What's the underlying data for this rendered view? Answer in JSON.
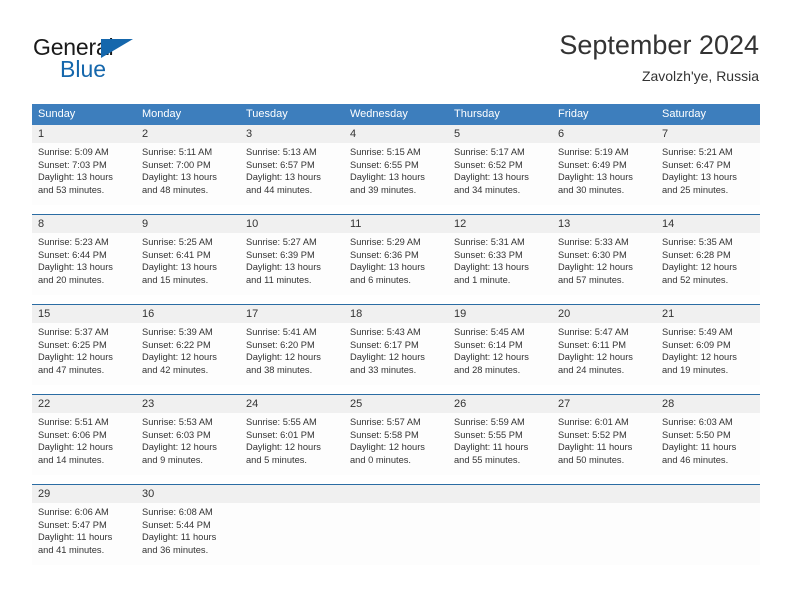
{
  "brand": {
    "name_part1": "General",
    "name_part2": "Blue",
    "logo_icon": "triangle-flag-icon"
  },
  "header": {
    "title": "September 2024",
    "subtitle": "Zavolzh'ye, Russia"
  },
  "colors": {
    "header_blue": "#3d7ebd",
    "row_divider": "#2b6ca3",
    "daynum_bg": "#f0f0f0",
    "brand_blue": "#1567ac",
    "text": "#333333"
  },
  "weekdays": [
    "Sunday",
    "Monday",
    "Tuesday",
    "Wednesday",
    "Thursday",
    "Friday",
    "Saturday"
  ],
  "weeks": [
    {
      "days": [
        {
          "date": "1",
          "sunrise": "Sunrise: 5:09 AM",
          "sunset": "Sunset: 7:03 PM",
          "daylight_line1": "Daylight: 13 hours",
          "daylight_line2": "and 53 minutes."
        },
        {
          "date": "2",
          "sunrise": "Sunrise: 5:11 AM",
          "sunset": "Sunset: 7:00 PM",
          "daylight_line1": "Daylight: 13 hours",
          "daylight_line2": "and 48 minutes."
        },
        {
          "date": "3",
          "sunrise": "Sunrise: 5:13 AM",
          "sunset": "Sunset: 6:57 PM",
          "daylight_line1": "Daylight: 13 hours",
          "daylight_line2": "and 44 minutes."
        },
        {
          "date": "4",
          "sunrise": "Sunrise: 5:15 AM",
          "sunset": "Sunset: 6:55 PM",
          "daylight_line1": "Daylight: 13 hours",
          "daylight_line2": "and 39 minutes."
        },
        {
          "date": "5",
          "sunrise": "Sunrise: 5:17 AM",
          "sunset": "Sunset: 6:52 PM",
          "daylight_line1": "Daylight: 13 hours",
          "daylight_line2": "and 34 minutes."
        },
        {
          "date": "6",
          "sunrise": "Sunrise: 5:19 AM",
          "sunset": "Sunset: 6:49 PM",
          "daylight_line1": "Daylight: 13 hours",
          "daylight_line2": "and 30 minutes."
        },
        {
          "date": "7",
          "sunrise": "Sunrise: 5:21 AM",
          "sunset": "Sunset: 6:47 PM",
          "daylight_line1": "Daylight: 13 hours",
          "daylight_line2": "and 25 minutes."
        }
      ]
    },
    {
      "days": [
        {
          "date": "8",
          "sunrise": "Sunrise: 5:23 AM",
          "sunset": "Sunset: 6:44 PM",
          "daylight_line1": "Daylight: 13 hours",
          "daylight_line2": "and 20 minutes."
        },
        {
          "date": "9",
          "sunrise": "Sunrise: 5:25 AM",
          "sunset": "Sunset: 6:41 PM",
          "daylight_line1": "Daylight: 13 hours",
          "daylight_line2": "and 15 minutes."
        },
        {
          "date": "10",
          "sunrise": "Sunrise: 5:27 AM",
          "sunset": "Sunset: 6:39 PM",
          "daylight_line1": "Daylight: 13 hours",
          "daylight_line2": "and 11 minutes."
        },
        {
          "date": "11",
          "sunrise": "Sunrise: 5:29 AM",
          "sunset": "Sunset: 6:36 PM",
          "daylight_line1": "Daylight: 13 hours",
          "daylight_line2": "and 6 minutes."
        },
        {
          "date": "12",
          "sunrise": "Sunrise: 5:31 AM",
          "sunset": "Sunset: 6:33 PM",
          "daylight_line1": "Daylight: 13 hours",
          "daylight_line2": "and 1 minute."
        },
        {
          "date": "13",
          "sunrise": "Sunrise: 5:33 AM",
          "sunset": "Sunset: 6:30 PM",
          "daylight_line1": "Daylight: 12 hours",
          "daylight_line2": "and 57 minutes."
        },
        {
          "date": "14",
          "sunrise": "Sunrise: 5:35 AM",
          "sunset": "Sunset: 6:28 PM",
          "daylight_line1": "Daylight: 12 hours",
          "daylight_line2": "and 52 minutes."
        }
      ]
    },
    {
      "days": [
        {
          "date": "15",
          "sunrise": "Sunrise: 5:37 AM",
          "sunset": "Sunset: 6:25 PM",
          "daylight_line1": "Daylight: 12 hours",
          "daylight_line2": "and 47 minutes."
        },
        {
          "date": "16",
          "sunrise": "Sunrise: 5:39 AM",
          "sunset": "Sunset: 6:22 PM",
          "daylight_line1": "Daylight: 12 hours",
          "daylight_line2": "and 42 minutes."
        },
        {
          "date": "17",
          "sunrise": "Sunrise: 5:41 AM",
          "sunset": "Sunset: 6:20 PM",
          "daylight_line1": "Daylight: 12 hours",
          "daylight_line2": "and 38 minutes."
        },
        {
          "date": "18",
          "sunrise": "Sunrise: 5:43 AM",
          "sunset": "Sunset: 6:17 PM",
          "daylight_line1": "Daylight: 12 hours",
          "daylight_line2": "and 33 minutes."
        },
        {
          "date": "19",
          "sunrise": "Sunrise: 5:45 AM",
          "sunset": "Sunset: 6:14 PM",
          "daylight_line1": "Daylight: 12 hours",
          "daylight_line2": "and 28 minutes."
        },
        {
          "date": "20",
          "sunrise": "Sunrise: 5:47 AM",
          "sunset": "Sunset: 6:11 PM",
          "daylight_line1": "Daylight: 12 hours",
          "daylight_line2": "and 24 minutes."
        },
        {
          "date": "21",
          "sunrise": "Sunrise: 5:49 AM",
          "sunset": "Sunset: 6:09 PM",
          "daylight_line1": "Daylight: 12 hours",
          "daylight_line2": "and 19 minutes."
        }
      ]
    },
    {
      "days": [
        {
          "date": "22",
          "sunrise": "Sunrise: 5:51 AM",
          "sunset": "Sunset: 6:06 PM",
          "daylight_line1": "Daylight: 12 hours",
          "daylight_line2": "and 14 minutes."
        },
        {
          "date": "23",
          "sunrise": "Sunrise: 5:53 AM",
          "sunset": "Sunset: 6:03 PM",
          "daylight_line1": "Daylight: 12 hours",
          "daylight_line2": "and 9 minutes."
        },
        {
          "date": "24",
          "sunrise": "Sunrise: 5:55 AM",
          "sunset": "Sunset: 6:01 PM",
          "daylight_line1": "Daylight: 12 hours",
          "daylight_line2": "and 5 minutes."
        },
        {
          "date": "25",
          "sunrise": "Sunrise: 5:57 AM",
          "sunset": "Sunset: 5:58 PM",
          "daylight_line1": "Daylight: 12 hours",
          "daylight_line2": "and 0 minutes."
        },
        {
          "date": "26",
          "sunrise": "Sunrise: 5:59 AM",
          "sunset": "Sunset: 5:55 PM",
          "daylight_line1": "Daylight: 11 hours",
          "daylight_line2": "and 55 minutes."
        },
        {
          "date": "27",
          "sunrise": "Sunrise: 6:01 AM",
          "sunset": "Sunset: 5:52 PM",
          "daylight_line1": "Daylight: 11 hours",
          "daylight_line2": "and 50 minutes."
        },
        {
          "date": "28",
          "sunrise": "Sunrise: 6:03 AM",
          "sunset": "Sunset: 5:50 PM",
          "daylight_line1": "Daylight: 11 hours",
          "daylight_line2": "and 46 minutes."
        }
      ]
    },
    {
      "days": [
        {
          "date": "29",
          "sunrise": "Sunrise: 6:06 AM",
          "sunset": "Sunset: 5:47 PM",
          "daylight_line1": "Daylight: 11 hours",
          "daylight_line2": "and 41 minutes."
        },
        {
          "date": "30",
          "sunrise": "Sunrise: 6:08 AM",
          "sunset": "Sunset: 5:44 PM",
          "daylight_line1": "Daylight: 11 hours",
          "daylight_line2": "and 36 minutes."
        },
        {
          "date": "",
          "sunrise": "",
          "sunset": "",
          "daylight_line1": "",
          "daylight_line2": ""
        },
        {
          "date": "",
          "sunrise": "",
          "sunset": "",
          "daylight_line1": "",
          "daylight_line2": ""
        },
        {
          "date": "",
          "sunrise": "",
          "sunset": "",
          "daylight_line1": "",
          "daylight_line2": ""
        },
        {
          "date": "",
          "sunrise": "",
          "sunset": "",
          "daylight_line1": "",
          "daylight_line2": ""
        },
        {
          "date": "",
          "sunrise": "",
          "sunset": "",
          "daylight_line1": "",
          "daylight_line2": ""
        }
      ]
    }
  ]
}
